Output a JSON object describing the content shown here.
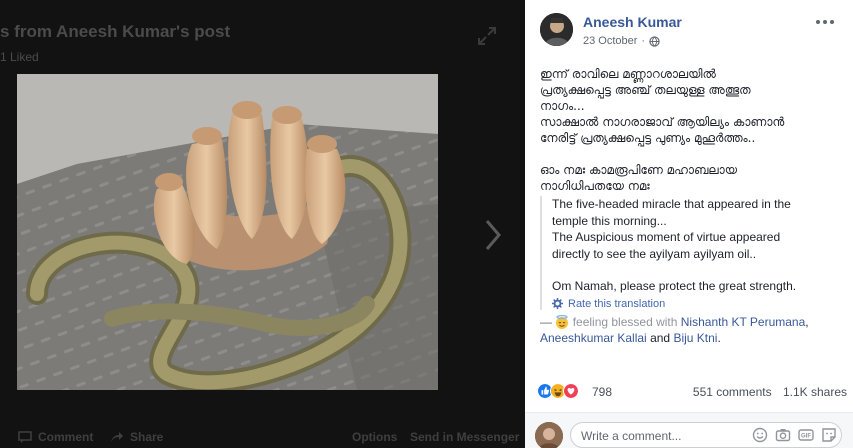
{
  "theater": {
    "title": "s from Aneesh Kumar's post",
    "subtitle": "1 Liked",
    "bar_comment": "Comment",
    "bar_share": "Share",
    "bar_options": "Options",
    "bar_send": "Send in Messenger"
  },
  "post": {
    "author": "Aneesh Kumar",
    "date": "23 October",
    "original_lines": [
      "ഇന്ന് രാവിലെ മണ്ണാറശാലയിൽ",
      "പ്രത്യക്ഷപ്പെട്ട അഞ്ച് തലയുള്ള അത്ഭുത",
      "നാഗം...",
      "സാക്ഷാൽ നാഗരാജാവ് ആയില്യം കാണാൻ",
      "നേരിട്ട് പ്രത്യക്ഷപ്പെട്ട പുണ്യം മുഹൂർത്തം.."
    ],
    "original_lines_2": [
      "ഓം നമഃ കാമരൂപിണേ മഹാബലായ",
      "നാഗിധിപതയേ നമഃ"
    ],
    "translation": [
      "The five-headed miracle that appeared in the",
      "temple this morning...",
      "The Auspicious moment of virtue appeared",
      "directly to see the ayilyam ayilyam oil.."
    ],
    "translation_2": "Om Namah, please protect the great strength.",
    "rate_translation": "Rate this translation",
    "feeling_dash": "—",
    "feeling_text": "feeling blessed with",
    "tag1": "Nishanth KT Perumana",
    "comma": ",",
    "tag2": "Aneeshkumar Kallai",
    "and": "and",
    "tag3": "Biju Ktni",
    "period": "."
  },
  "stats": {
    "reaction_count": "798",
    "comments": "551 comments",
    "shares": "1.1K shares"
  },
  "comment": {
    "placeholder": "Write a comment..."
  },
  "colors": {
    "link": "#385898",
    "like_blue": "#1877f2",
    "haha_yellow": "#f7b125",
    "love_red": "#f33e58"
  }
}
